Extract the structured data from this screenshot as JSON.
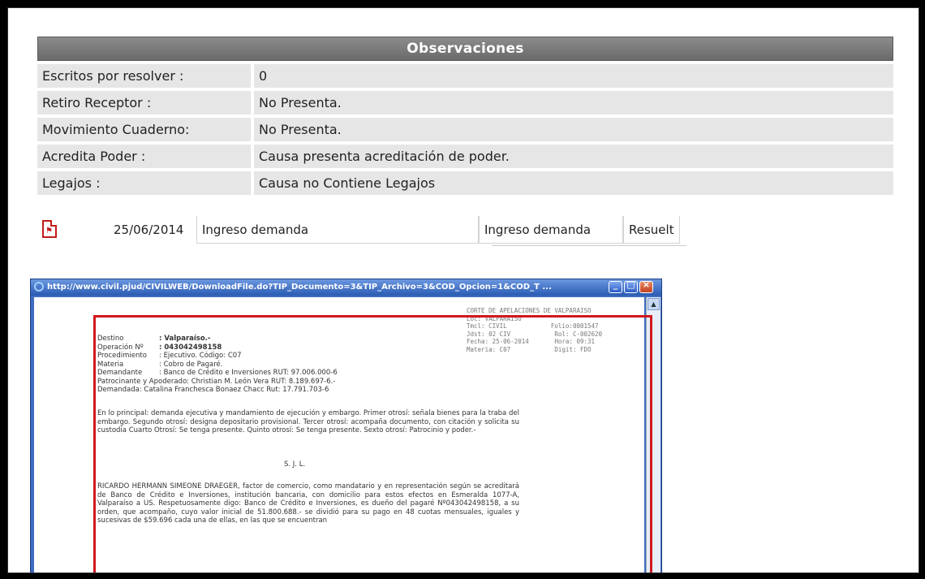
{
  "observaciones": {
    "title": "Observaciones",
    "rows": [
      {
        "label": "Escritos por resolver :",
        "value": "0"
      },
      {
        "label": "Retiro Receptor :",
        "value": "No Presenta."
      },
      {
        "label": "Movimiento Cuaderno:",
        "value": "No Presenta."
      },
      {
        "label": "Acredita Poder :",
        "value": "Causa presenta acreditación de poder."
      },
      {
        "label": "Legajos :",
        "value": "Causa no Contiene Legajos"
      }
    ]
  },
  "document_row": {
    "icon": "pdf-icon",
    "date": "25/06/2014",
    "tramite": "Ingreso demanda",
    "descripcion": "Ingreso demanda",
    "estado": "Resuelt"
  },
  "popup": {
    "url": "http://www.civil.pjud/CIVILWEB/DownloadFile.do?TIP_Documento=3&TIP_Archivo=3&COD_Opcion=1&COD_T ...",
    "stamp": "CORTE DE APELACIONES DE VALPARAISO\nLoc: VALPARAISO\nTmcl: CIVIL            Folio:0001547\nJdst: 02 CIV            Rol: C-002620\nFecha: 25-06-2014       Hora: 09:31\nMateria: C07            Digit: FDO",
    "fields": [
      {
        "label": "Destino",
        "value": ": Valparaíso.-",
        "bold": true
      },
      {
        "label": "Operación Nº",
        "value": ": 043042498158",
        "bold": true
      },
      {
        "label": "Procedimiento",
        "value": ": Ejecutivo.          Código: C07",
        "bold": false
      },
      {
        "label": "Materia",
        "value": ": Cobro de Pagaré.",
        "bold": false
      },
      {
        "label": "Demandante",
        "value": ": Banco de Crédito e Inversiones RUT: 97.006.000-6",
        "bold": false
      },
      {
        "label": "Patrocinante y Apoderado:",
        "value": " Christian M. León Vera  RUT: 8.189.697-6.-",
        "bold": false
      },
      {
        "label": "Demandada:",
        "value": " Catalina Franchesca Bonaez Chacc Rut: 17.791.703-6",
        "bold": false
      }
    ],
    "para1": "En lo principal: demanda ejecutiva y mandamiento de ejecución y embargo. Primer otrosí: señala bienes para la traba del embargo. Segundo otrosí: designa depositario provisional. Tercer otrosí: acompaña documento, con citación y solicita su custodia Cuarto Otrosí: Se tenga presente. Quinto otrosí: Se tenga presente. Sexto otrosí: Patrocinio y poder.-",
    "sal": "S. J. L.",
    "para2": "RICARDO HERMANN SIMEONE DRAEGER, factor de comercio, como mandatario y en representación según se acreditará de Banco de Crédito e Inversiones, institución bancaria, con domicilio para estos efectos en Esmeralda 1077-A, Valparaíso a US. Respetuosamente digo: Banco de Crédito e Inversiones, es dueño del pagaré Nº043042498158, a su orden, que acompaño, cuyo valor inicial de 51.800.688.- se dividió para su pago en 48 cuotas mensuales, iguales y sucesivas de $59.696 cada una de ellas, en las que se encuentran"
  },
  "colors": {
    "highlight_box": "#d0181c",
    "header_bg": "#7a7a7a",
    "row_bg": "#e6e6e6"
  }
}
